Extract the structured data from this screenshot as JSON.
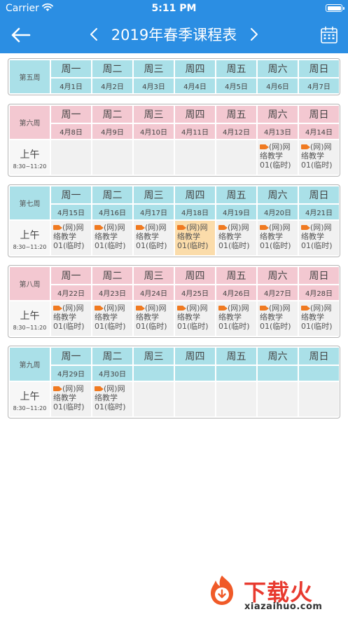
{
  "status_bar": {
    "carrier": "Carrier",
    "time": "5:11 PM"
  },
  "header": {
    "title": "2019年春季课程表"
  },
  "weekdays": [
    "周一",
    "周二",
    "周三",
    "周四",
    "周五",
    "周六",
    "周日"
  ],
  "period": {
    "name": "上午",
    "time": "8:30~11:20"
  },
  "course_text": "(网)网络教学01(临时)",
  "colors": {
    "primary": "#2b8ee3",
    "cyan_header": "#aae0e8",
    "pink_header": "#f3c8d1",
    "highlight": "#fbdcaa",
    "camera_icon": "#f07a21"
  },
  "weeks": [
    {
      "label": "第五周",
      "theme": "cyan",
      "dates": [
        "4月1日",
        "4月2日",
        "4月3日",
        "4月4日",
        "4月5日",
        "4月6日",
        "4月7日"
      ],
      "show_period": false,
      "courses": [
        false,
        false,
        false,
        false,
        false,
        false,
        false
      ],
      "highlight_index": -1
    },
    {
      "label": "第六周",
      "theme": "pink",
      "dates": [
        "4月8日",
        "4月9日",
        "4月10日",
        "4月11日",
        "4月12日",
        "4月13日",
        "4月14日"
      ],
      "show_period": true,
      "courses": [
        false,
        false,
        false,
        false,
        false,
        true,
        true
      ],
      "highlight_index": -1
    },
    {
      "label": "第七周",
      "theme": "cyan",
      "dates": [
        "4月15日",
        "4月16日",
        "4月17日",
        "4月18日",
        "4月19日",
        "4月20日",
        "4月21日"
      ],
      "show_period": true,
      "courses": [
        true,
        true,
        true,
        true,
        true,
        true,
        true
      ],
      "highlight_index": 3
    },
    {
      "label": "第八周",
      "theme": "pink",
      "dates": [
        "4月22日",
        "4月23日",
        "4月24日",
        "4月25日",
        "4月26日",
        "4月27日",
        "4月28日"
      ],
      "show_period": true,
      "courses": [
        true,
        true,
        true,
        true,
        true,
        true,
        true
      ],
      "highlight_index": -1
    },
    {
      "label": "第九周",
      "theme": "cyan",
      "dates": [
        "4月29日",
        "4月30日",
        "",
        "",
        "",
        "",
        ""
      ],
      "show_period": true,
      "courses": [
        true,
        true,
        false,
        false,
        false,
        false,
        false
      ],
      "highlight_index": -1
    }
  ],
  "watermark": {
    "brand": "下载火",
    "url": "xiazaihuo.com"
  }
}
